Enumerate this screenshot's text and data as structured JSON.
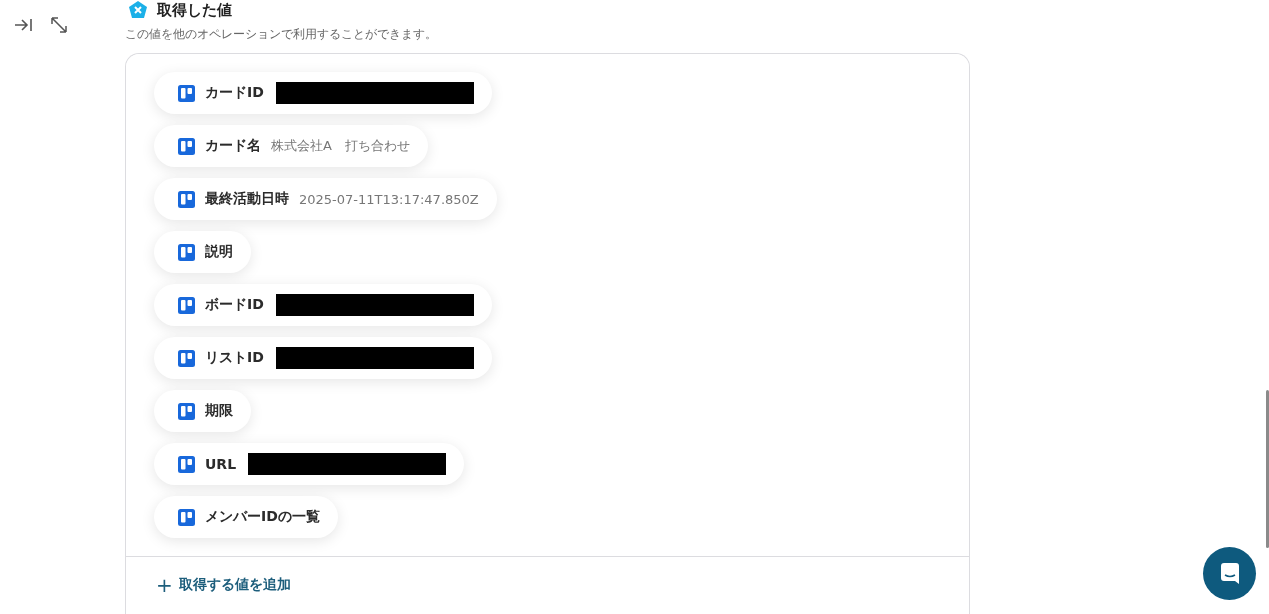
{
  "section": {
    "title": "取得した値",
    "description": "この値を他のオペレーションで利用することができます。"
  },
  "values": [
    {
      "label": "カードID",
      "redacted": true
    },
    {
      "label": "カード名",
      "value": "株式会社A　打ち合わせ",
      "redacted": false
    },
    {
      "label": "最終活動日時",
      "value": "2025-07-11T13:17:47.850Z",
      "redacted": false
    },
    {
      "label": "説明",
      "redacted": false
    },
    {
      "label": "ボードID",
      "redacted": true
    },
    {
      "label": "リストID",
      "redacted": true
    },
    {
      "label": "期限",
      "redacted": false
    },
    {
      "label": "URL",
      "redacted": true
    },
    {
      "label": "メンバーIDの一覧",
      "redacted": false
    }
  ],
  "add_button": {
    "icon": "+",
    "label": "取得する値を追加"
  }
}
